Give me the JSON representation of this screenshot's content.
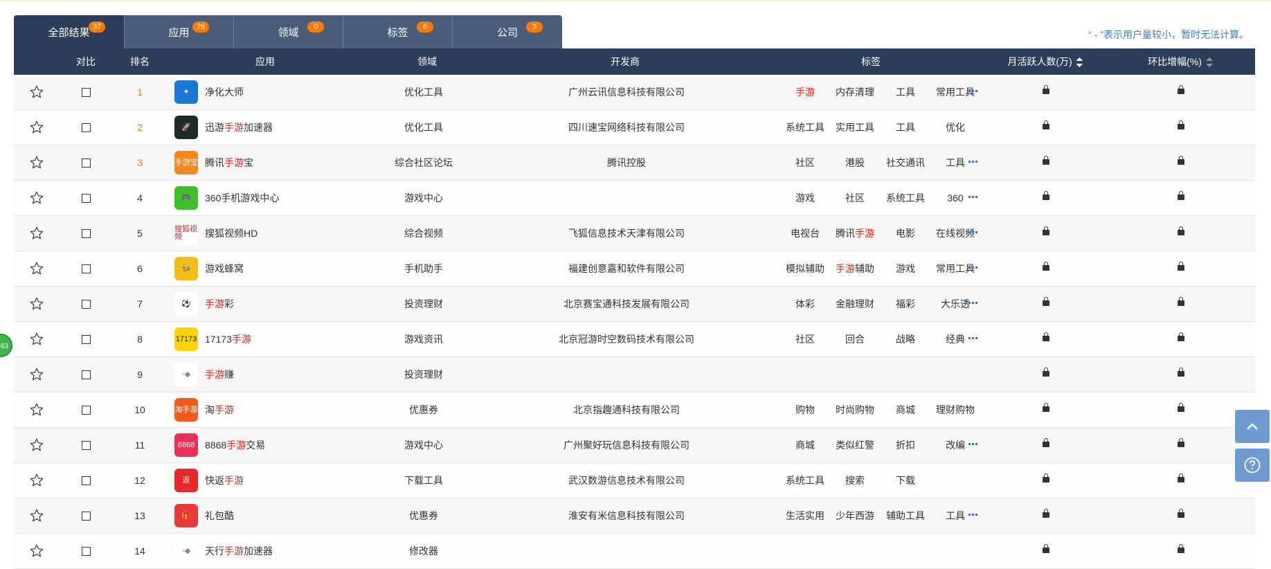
{
  "tabs": [
    {
      "label": "全部结果",
      "count": "37"
    },
    {
      "label": "应用",
      "count": "28"
    },
    {
      "label": "领域",
      "count": "0"
    },
    {
      "label": "标签",
      "count": "6"
    },
    {
      "label": "公司",
      "count": "3"
    }
  ],
  "note": "“ - ”表示用户量较小，暂时无法计算。",
  "columns": {
    "compare": "对比",
    "rank": "排名",
    "app": "应用",
    "domain": "领域",
    "developer": "开发商",
    "tags": "标签",
    "mau": "月活跃人数(万)",
    "growth": "环比增幅(%)"
  },
  "rows": [
    {
      "rank": "1",
      "name": [
        {
          "t": "净化大师"
        }
      ],
      "domain": "优化工具",
      "dev": "广州云讯信息科技有限公司",
      "tags": [
        [
          {
            "t": "手游",
            "h": true
          }
        ],
        [
          {
            "t": "内存清理"
          }
        ],
        [
          {
            "t": "工具"
          }
        ],
        [
          {
            "t": "常用工具"
          }
        ]
      ],
      "more": true,
      "icon": {
        "bg": "#1a78d8",
        "text": "✦"
      }
    },
    {
      "rank": "2",
      "name": [
        {
          "t": "迅游"
        },
        {
          "t": "手游",
          "h": true
        },
        {
          "t": "加速器"
        }
      ],
      "domain": "优化工具",
      "dev": "四川速宝网络科技有限公司",
      "tags": [
        [
          {
            "t": "系统工具"
          }
        ],
        [
          {
            "t": "实用工具"
          }
        ],
        [
          {
            "t": "工具"
          }
        ],
        [
          {
            "t": "优化"
          }
        ]
      ],
      "more": false,
      "icon": {
        "bg": "#1f2a2c",
        "text": "🚀"
      }
    },
    {
      "rank": "3",
      "name": [
        {
          "t": "腾讯"
        },
        {
          "t": "手游",
          "h": true
        },
        {
          "t": "宝"
        }
      ],
      "domain": "综合社区论坛",
      "dev": "腾讯控股",
      "tags": [
        [
          {
            "t": "社区"
          }
        ],
        [
          {
            "t": "港股"
          }
        ],
        [
          {
            "t": "社交通讯"
          }
        ],
        [
          {
            "t": "工具"
          }
        ]
      ],
      "more": true,
      "icon": {
        "bg": "#f5871f",
        "text": "手游宝"
      }
    },
    {
      "rank": "4",
      "name": [
        {
          "t": "360手机游戏中心"
        }
      ],
      "domain": "游戏中心",
      "dev": "",
      "tags": [
        [
          {
            "t": "游戏"
          }
        ],
        [
          {
            "t": "社区"
          }
        ],
        [
          {
            "t": "系统工具"
          }
        ],
        [
          {
            "t": "360"
          }
        ]
      ],
      "more": true,
      "icon": {
        "bg": "#3fbf2a",
        "text": "🎮"
      }
    },
    {
      "rank": "5",
      "name": [
        {
          "t": "搜狐视频HD"
        }
      ],
      "domain": "综合视频",
      "dev": "飞狐信息技术天津有限公司",
      "tags": [
        [
          {
            "t": "电视台"
          }
        ],
        [
          {
            "t": "腾讯"
          },
          {
            "t": "手游",
            "h": true
          }
        ],
        [
          {
            "t": "电影"
          }
        ],
        [
          {
            "t": "在线视频"
          }
        ]
      ],
      "more": true,
      "icon": {
        "bg": "#ffffff",
        "text": "搜狐视频",
        "fg": "#d4232a"
      }
    },
    {
      "rank": "6",
      "name": [
        {
          "t": "游戏蜂窝"
        }
      ],
      "domain": "手机助手",
      "dev": "福建创意嘉和软件有限公司",
      "tags": [
        [
          {
            "t": "模拟辅助"
          }
        ],
        [
          {
            "t": "手游",
            "h": true
          },
          {
            "t": "辅助"
          }
        ],
        [
          {
            "t": "游戏"
          }
        ],
        [
          {
            "t": "常用工具"
          }
        ]
      ],
      "more": true,
      "icon": {
        "bg": "#f6bd16",
        "text": "🐝"
      }
    },
    {
      "rank": "7",
      "name": [
        {
          "t": "手游",
          "h": true
        },
        {
          "t": "彩"
        }
      ],
      "domain": "投资理财",
      "dev": "北京赛宝通科技发展有限公司",
      "tags": [
        [
          {
            "t": "体彩"
          }
        ],
        [
          {
            "t": "金融理财"
          }
        ],
        [
          {
            "t": "福彩"
          }
        ],
        [
          {
            "t": "大乐透"
          }
        ]
      ],
      "more": true,
      "icon": {
        "bg": "#ffffff",
        "text": "⚽",
        "fg": "#e03030"
      }
    },
    {
      "rank": "8",
      "name": [
        {
          "t": "17173"
        },
        {
          "t": "手游",
          "h": true
        }
      ],
      "domain": "游戏资讯",
      "dev": "北京冠游时空数码技术有限公司",
      "tags": [
        [
          {
            "t": "社区"
          }
        ],
        [
          {
            "t": "回合"
          }
        ],
        [
          {
            "t": "战略"
          }
        ],
        [
          {
            "t": "经典"
          }
        ]
      ],
      "more": true,
      "icon": {
        "bg": "#ffd400",
        "text": "17173",
        "fg": "#222"
      }
    },
    {
      "rank": "9",
      "name": [
        {
          "t": "手游",
          "h": true
        },
        {
          "t": "赚"
        }
      ],
      "domain": "投资理财",
      "dev": "",
      "tags": [],
      "more": false,
      "icon": {
        "bg": "#ffffff",
        "text": "▫◆",
        "fg": "#888"
      }
    },
    {
      "rank": "10",
      "name": [
        {
          "t": "淘"
        },
        {
          "t": "手游",
          "h": true
        }
      ],
      "domain": "优惠券",
      "dev": "北京指趣通科技有限公司",
      "tags": [
        [
          {
            "t": "购物"
          }
        ],
        [
          {
            "t": "时尚购物"
          }
        ],
        [
          {
            "t": "商城"
          }
        ],
        [
          {
            "t": "理财购物"
          }
        ]
      ],
      "more": false,
      "icon": {
        "bg": "#f25c19",
        "text": "淘手游"
      }
    },
    {
      "rank": "11",
      "name": [
        {
          "t": "8868"
        },
        {
          "t": "手游",
          "h": true
        },
        {
          "t": "交易"
        }
      ],
      "domain": "游戏中心",
      "dev": "广州聚好玩信息科技有限公司",
      "tags": [
        [
          {
            "t": "商城"
          }
        ],
        [
          {
            "t": "类似红警"
          }
        ],
        [
          {
            "t": "折扣"
          }
        ],
        [
          {
            "t": "改编"
          }
        ]
      ],
      "more": true,
      "icon": {
        "bg": "#e8305a",
        "text": "8868"
      }
    },
    {
      "rank": "12",
      "name": [
        {
          "t": "快返"
        },
        {
          "t": "手游",
          "h": true
        }
      ],
      "domain": "下载工具",
      "dev": "武汉数游信息技术有限公司",
      "tags": [
        [
          {
            "t": "系统工具"
          }
        ],
        [
          {
            "t": "搜索"
          }
        ],
        [
          {
            "t": "下载"
          }
        ]
      ],
      "more": false,
      "icon": {
        "bg": "#e82828",
        "text": "返"
      }
    },
    {
      "rank": "13",
      "name": [
        {
          "t": "礼包酷"
        }
      ],
      "domain": "优惠券",
      "dev": "淮安有米信息科技有限公司",
      "tags": [
        [
          {
            "t": "生活实用"
          }
        ],
        [
          {
            "t": "少年西游"
          }
        ],
        [
          {
            "t": "辅助工具"
          }
        ],
        [
          {
            "t": "工具"
          }
        ]
      ],
      "more": true,
      "icon": {
        "bg": "#e83a3a",
        "text": "🎁"
      }
    },
    {
      "rank": "14",
      "name": [
        {
          "t": "天行"
        },
        {
          "t": "手游",
          "h": true
        },
        {
          "t": "加速器"
        }
      ],
      "domain": "修改器",
      "dev": "",
      "tags": [],
      "more": false,
      "icon": {
        "bg": "#ffffff",
        "text": "▫◆",
        "fg": "#888"
      }
    }
  ],
  "side_badge": "63",
  "colors": {
    "header": "#2c3e5a",
    "tab": "#4a5d79",
    "badge": "#ff7a00",
    "highlight": "#e8231d",
    "rank_top": "#f07a1a",
    "link": "#3b7fc4"
  }
}
